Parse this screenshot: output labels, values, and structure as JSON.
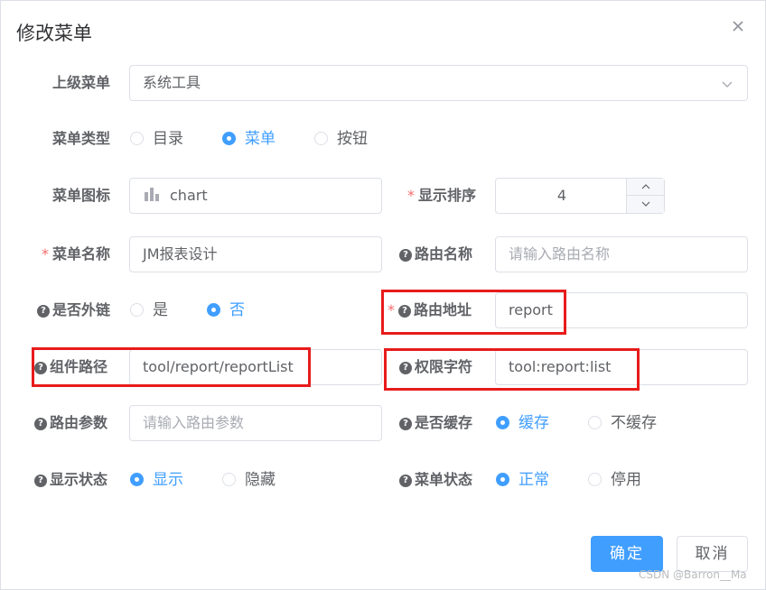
{
  "dialog": {
    "title": "修改菜单"
  },
  "icons": {
    "close": "close-icon",
    "dropdown": "chevron-down-icon",
    "help": "question-circle-icon",
    "menu_icon": "bar-chart-icon"
  },
  "colors": {
    "primary": "#409eff",
    "required": "#f56c6c",
    "highlight": "#e81b1b"
  },
  "form": {
    "parent": {
      "label": "上级菜单",
      "value": "系统工具"
    },
    "type": {
      "label": "菜单类型",
      "options": [
        "目录",
        "菜单",
        "按钮"
      ],
      "selected": "菜单"
    },
    "icon": {
      "label": "菜单图标",
      "value": "chart"
    },
    "order": {
      "label": "显示排序",
      "required_mark": "*",
      "value": "4"
    },
    "name": {
      "label": "菜单名称",
      "required_mark": "*",
      "value": "JM报表设计"
    },
    "route_name": {
      "label": "路由名称",
      "placeholder": "请输入路由名称"
    },
    "is_frame": {
      "label": "是否外链",
      "options": [
        "是",
        "否"
      ],
      "selected": "否"
    },
    "path": {
      "label": "路由地址",
      "required_mark": "*",
      "value": "report"
    },
    "component": {
      "label": "组件路径",
      "value": "tool/report/reportList"
    },
    "perms": {
      "label": "权限字符",
      "value": "tool:report:list"
    },
    "query": {
      "label": "路由参数",
      "placeholder": "请输入路由参数"
    },
    "cache": {
      "label": "是否缓存",
      "options": [
        "缓存",
        "不缓存"
      ],
      "selected": "缓存"
    },
    "visible": {
      "label": "显示状态",
      "options": [
        "显示",
        "隐藏"
      ],
      "selected": "显示"
    },
    "status": {
      "label": "菜单状态",
      "options": [
        "正常",
        "停用"
      ],
      "selected": "正常"
    }
  },
  "footer": {
    "confirm": "确定",
    "cancel": "取消"
  },
  "watermark": "CSDN @Barron__Ma"
}
